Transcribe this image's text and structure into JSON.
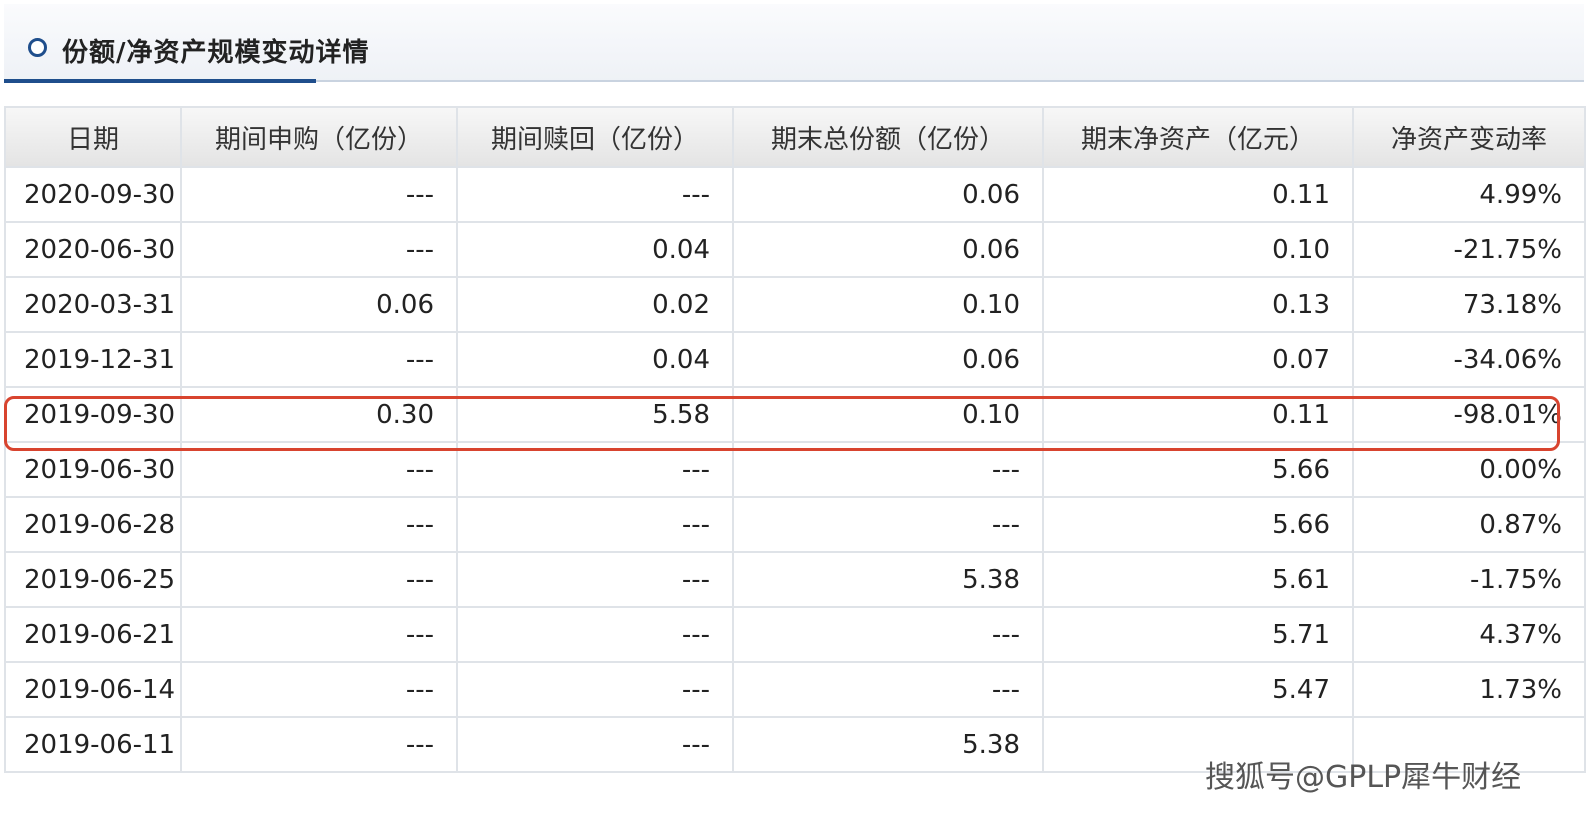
{
  "panel": {
    "title": "份额/净资产规模变动详情"
  },
  "table": {
    "headers": [
      "日期",
      "期间申购（亿份）",
      "期间赎回（亿份）",
      "期末总份额（亿份）",
      "期末净资产（亿元）",
      "净资产变动率"
    ],
    "rows": [
      [
        "2020-09-30",
        "---",
        "---",
        "0.06",
        "0.11",
        "4.99%"
      ],
      [
        "2020-06-30",
        "---",
        "0.04",
        "0.06",
        "0.10",
        "-21.75%"
      ],
      [
        "2020-03-31",
        "0.06",
        "0.02",
        "0.10",
        "0.13",
        "73.18%"
      ],
      [
        "2019-12-31",
        "---",
        "0.04",
        "0.06",
        "0.07",
        "-34.06%"
      ],
      [
        "2019-09-30",
        "0.30",
        "5.58",
        "0.10",
        "0.11",
        "-98.01%"
      ],
      [
        "2019-06-30",
        "---",
        "---",
        "---",
        "5.66",
        "0.00%"
      ],
      [
        "2019-06-28",
        "---",
        "---",
        "---",
        "5.66",
        "0.87%"
      ],
      [
        "2019-06-25",
        "---",
        "---",
        "5.38",
        "5.61",
        "-1.75%"
      ],
      [
        "2019-06-21",
        "---",
        "---",
        "---",
        "5.71",
        "4.37%"
      ],
      [
        "2019-06-14",
        "---",
        "---",
        "---",
        "5.47",
        "1.73%"
      ],
      [
        "2019-06-11",
        "---",
        "---",
        "5.38",
        "",
        ""
      ]
    ],
    "highlighted_row_date": "2019-09-30",
    "highlight_color": "#d8442f"
  },
  "watermark": "搜狐号@GPLP犀牛财经"
}
